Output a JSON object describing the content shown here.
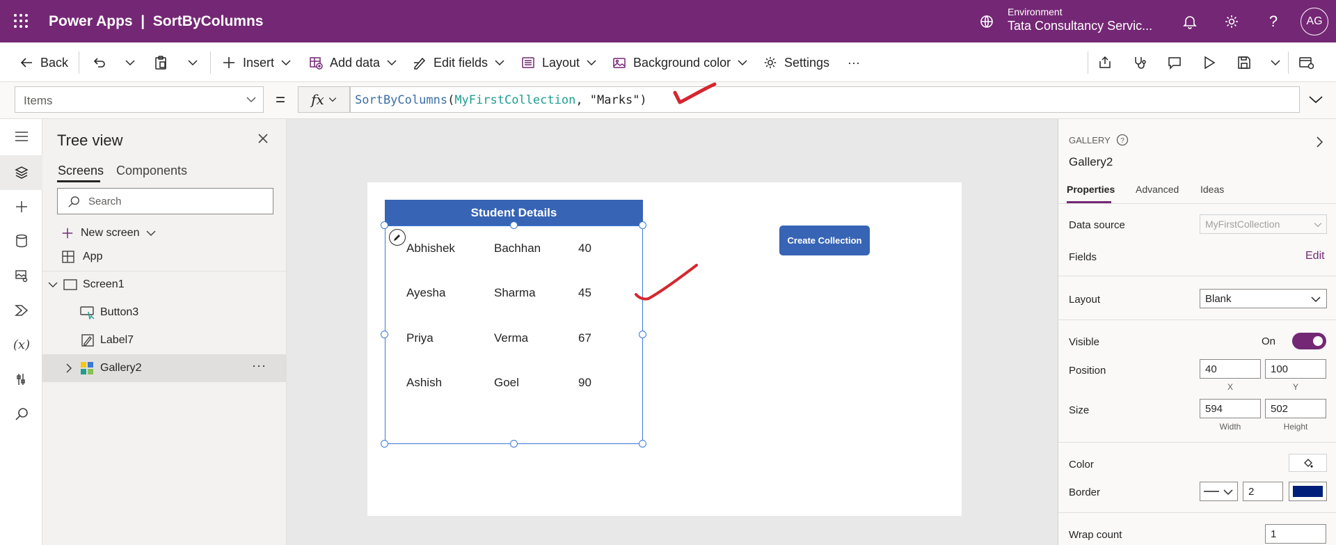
{
  "header": {
    "app_title": "Power Apps  |  SortByColumns",
    "environment_label": "Environment",
    "environment_name": "Tata Consultancy Servic...",
    "avatar_initials": "AG"
  },
  "commandbar": {
    "back": "Back",
    "insert": "Insert",
    "add_data": "Add data",
    "edit_fields": "Edit fields",
    "layout": "Layout",
    "background_color": "Background color",
    "settings": "Settings",
    "more": "···"
  },
  "formula_bar": {
    "property": "Items",
    "equals": "=",
    "fx": "fx",
    "formula_fn": "SortByColumns",
    "formula_open": "(",
    "formula_var": "MyFirstCollection",
    "formula_rest": ", \"Marks\")"
  },
  "tree": {
    "title": "Tree view",
    "tab_screens": "Screens",
    "tab_components": "Components",
    "search_placeholder": "Search",
    "new_screen": "New screen",
    "items": [
      "App",
      "Screen1",
      "Button3",
      "Label7",
      "Gallery2"
    ]
  },
  "canvas": {
    "gallery_title": "Student Details",
    "rows": [
      {
        "first": "Abhishek",
        "last": "Bachhan",
        "marks": "40"
      },
      {
        "first": "Ayesha",
        "last": "Sharma",
        "marks": "45"
      },
      {
        "first": "Priya",
        "last": "Verma",
        "marks": "67"
      },
      {
        "first": "Ashish",
        "last": "Goel",
        "marks": "90"
      }
    ],
    "button_label": "Create Collection"
  },
  "properties": {
    "type": "GALLERY",
    "name": "Gallery2",
    "tabs": [
      "Properties",
      "Advanced",
      "Ideas"
    ],
    "data_source_label": "Data source",
    "data_source_value": "MyFirstCollection",
    "fields_label": "Fields",
    "fields_edit": "Edit",
    "layout_label": "Layout",
    "layout_value": "Blank",
    "visible_label": "Visible",
    "visible_value": "On",
    "position_label": "Position",
    "position_x": "40",
    "position_y": "100",
    "x_cap": "X",
    "y_cap": "Y",
    "size_label": "Size",
    "size_width": "594",
    "size_height": "502",
    "width_cap": "Width",
    "height_cap": "Height",
    "color_label": "Color",
    "border_label": "Border",
    "border_width": "2",
    "border_color": "#001f7a",
    "wrap_count_label": "Wrap count",
    "wrap_count_value": "1"
  },
  "colors": {
    "brand": "#742774",
    "gallery_blue": "#3764b4",
    "selection_blue": "#3b78d8",
    "annotation_red": "#d6262f"
  }
}
